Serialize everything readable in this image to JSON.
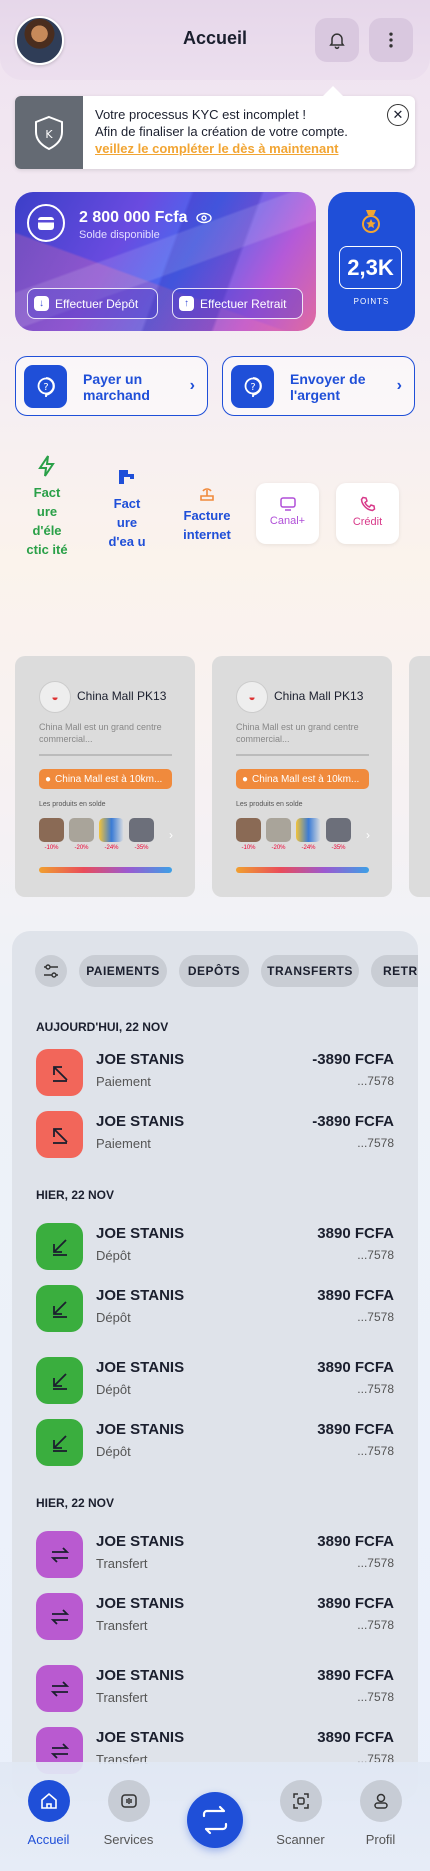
{
  "header": {
    "title": "Accueil"
  },
  "kyc": {
    "line1": "Votre processus KYC est incomplet !",
    "line2": "Afin de finaliser la création de votre compte.",
    "link": "veillez le compléter le dès à maintenant"
  },
  "balance": {
    "amount": "2 800 000 Fcfa",
    "label": "Solde disponible",
    "deposit_label": "Effectuer Dépôt",
    "withdraw_label": "Effectuer Retrait"
  },
  "points": {
    "value": "2,3K",
    "label": "POINTS"
  },
  "actions": [
    {
      "label": "Payer un marchand"
    },
    {
      "label": "Envoyer de l'argent"
    }
  ],
  "services": [
    {
      "label": "Fact ure d'éle ctic ité",
      "color": "#2aa048"
    },
    {
      "label": "Fact ure d'ea u",
      "color": "#1f4fd8"
    },
    {
      "label": "Facture internet",
      "color": "#1f4fd8"
    },
    {
      "label": "Canal+",
      "color": "#b04fd8"
    },
    {
      "label": "Crédit",
      "color": "#d83a8a"
    }
  ],
  "stores": [
    {
      "name": "China Mall PK13",
      "description": "China Mall est un grand centre commercial...",
      "location": "China Mall est à 10km...",
      "products_label": "Les produits en solde",
      "discounts": [
        "-10%",
        "-20%",
        "-24%",
        "-35%"
      ]
    },
    {
      "name": "China Mall PK13",
      "description": "China Mall est un grand centre commercial...",
      "location": "China Mall est à 10km...",
      "products_label": "Les produits en solde",
      "discounts": [
        "-10%",
        "-20%",
        "-24%",
        "-35%"
      ]
    }
  ],
  "filters": [
    "PAIEMENTS",
    "DEPÔTS",
    "TRANSFERTS",
    "RETRAITS"
  ],
  "sections": [
    {
      "title": "AUJOURD'HUI, 22 NOV",
      "items": [
        {
          "name": "JOE STANIS",
          "type": "Paiement",
          "amount": "-3890 FCFA",
          "ref": "...7578"
        },
        {
          "name": "JOE STANIS",
          "type": "Paiement",
          "amount": "-3890 FCFA",
          "ref": "...7578"
        }
      ]
    },
    {
      "title": "HIER, 22 NOV",
      "items": [
        {
          "name": "JOE STANIS",
          "type": "Dépôt",
          "amount": "3890 FCFA",
          "ref": "...7578"
        },
        {
          "name": "JOE STANIS",
          "type": "Dépôt",
          "amount": "3890 FCFA",
          "ref": "...7578"
        },
        {
          "name": "JOE STANIS",
          "type": "Dépôt",
          "amount": "3890 FCFA",
          "ref": "...7578"
        },
        {
          "name": "JOE STANIS",
          "type": "Dépôt",
          "amount": "3890 FCFA",
          "ref": "...7578"
        }
      ]
    },
    {
      "title": "HIER, 22 NOV",
      "items": [
        {
          "name": "JOE STANIS",
          "type": "Transfert",
          "amount": "3890 FCFA",
          "ref": "...7578"
        },
        {
          "name": "JOE STANIS",
          "type": "Transfert",
          "amount": "3890 FCFA",
          "ref": "...7578"
        },
        {
          "name": "JOE STANIS",
          "type": "Transfert",
          "amount": "3890 FCFA",
          "ref": "...7578"
        },
        {
          "name": "JOE STANIS",
          "type": "Transfert",
          "amount": "3890 FCFA",
          "ref": "...7578"
        }
      ]
    }
  ],
  "nav": {
    "home": "Accueil",
    "services": "Services",
    "scanner": "Scanner",
    "profile": "Profil"
  },
  "colors": {
    "primary": "#1f4fd8",
    "payment": "#f2665a",
    "deposit": "#3aae3e",
    "transfer": "#b95ad0",
    "warning": "#f2a533"
  }
}
